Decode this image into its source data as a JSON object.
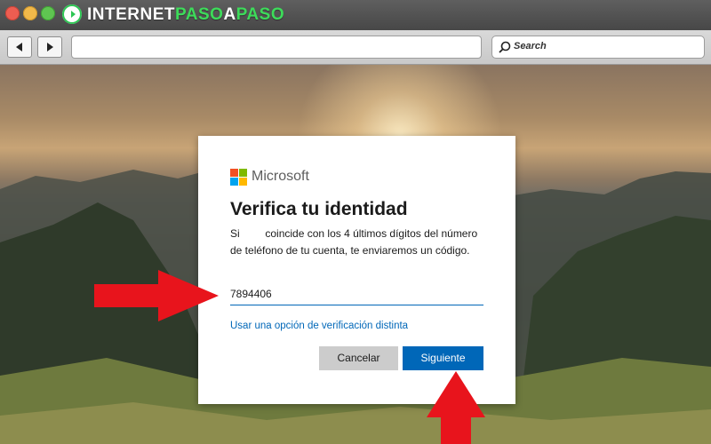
{
  "browser": {
    "brand": {
      "part1": "INTERNET",
      "part2": "PASO",
      "part3": "A",
      "part4": "PASO"
    },
    "url": "",
    "search_placeholder": "Search"
  },
  "dialog": {
    "brand_name": "Microsoft",
    "title": "Verifica tu identidad",
    "text_prefix": "Si",
    "text_suffix": "coincide con los 4 últimos dígitos del número de teléfono de tu cuenta, te enviaremos un código.",
    "input_value": "7894406",
    "alt_link": "Usar una opción de verificación distinta",
    "cancel_label": "Cancelar",
    "next_label": "Siguiente"
  },
  "colors": {
    "ms_accent": "#0067b8",
    "arrow": "#e8141c",
    "brand_green": "#3ddb5a",
    "logo_red": "#f25022",
    "logo_green": "#7fba00",
    "logo_blue": "#00a4ef",
    "logo_yellow": "#ffb900"
  },
  "icons": [
    "back-arrow-icon",
    "forward-arrow-icon",
    "search-icon",
    "microsoft-logo-icon",
    "red-arrow-right-icon",
    "red-arrow-up-icon"
  ]
}
